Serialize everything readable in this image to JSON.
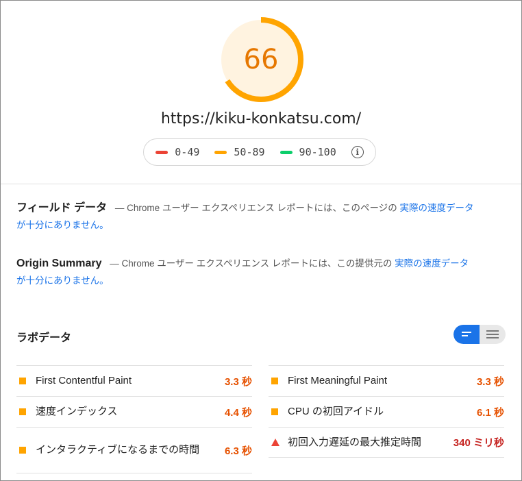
{
  "header": {
    "score": "66",
    "score_fraction": 0.66,
    "url": "https://kiku-konkatsu.com/"
  },
  "legend": {
    "items": [
      {
        "label": "0-49",
        "color": "#eb4335"
      },
      {
        "label": "50-89",
        "color": "#ffa400"
      },
      {
        "label": "90-100",
        "color": "#0cce6b"
      }
    ],
    "info_icon": "info-icon"
  },
  "field_data": {
    "title": "フィールド データ",
    "text": "— Chrome ユーザー エクスペリエンス レポートには、このページの",
    "link": "実際の速度データが十分にありません。"
  },
  "origin_summary": {
    "title": "Origin Summary",
    "text": "— Chrome ユーザー エクスペリエンス レポートには、この提供元の",
    "link": "実際の速度データが十分にありません。"
  },
  "lab_data": {
    "title": "ラボデータ",
    "toggle": [
      "bars-view-icon",
      "list-view-icon"
    ]
  },
  "metrics_left": [
    {
      "label": "First Contentful Paint",
      "value": "3.3 秒",
      "status": "average"
    },
    {
      "label": "速度インデックス",
      "value": "4.4 秒",
      "status": "average"
    },
    {
      "label": "インタラクティブになるまでの時間",
      "value": "6.3 秒",
      "status": "average"
    }
  ],
  "metrics_right": [
    {
      "label": "First Meaningful Paint",
      "value": "3.3 秒",
      "status": "average"
    },
    {
      "label": "CPU の初回アイドル",
      "value": "6.1 秒",
      "status": "average"
    },
    {
      "label": "初回入力遅延の最大推定時間",
      "value": "340 ミリ秒",
      "status": "fail"
    }
  ],
  "colors": {
    "average": "#ffa400",
    "fail": "#eb4335",
    "link": "#1a73e8",
    "gauge_bg": "#fff3e0"
  }
}
